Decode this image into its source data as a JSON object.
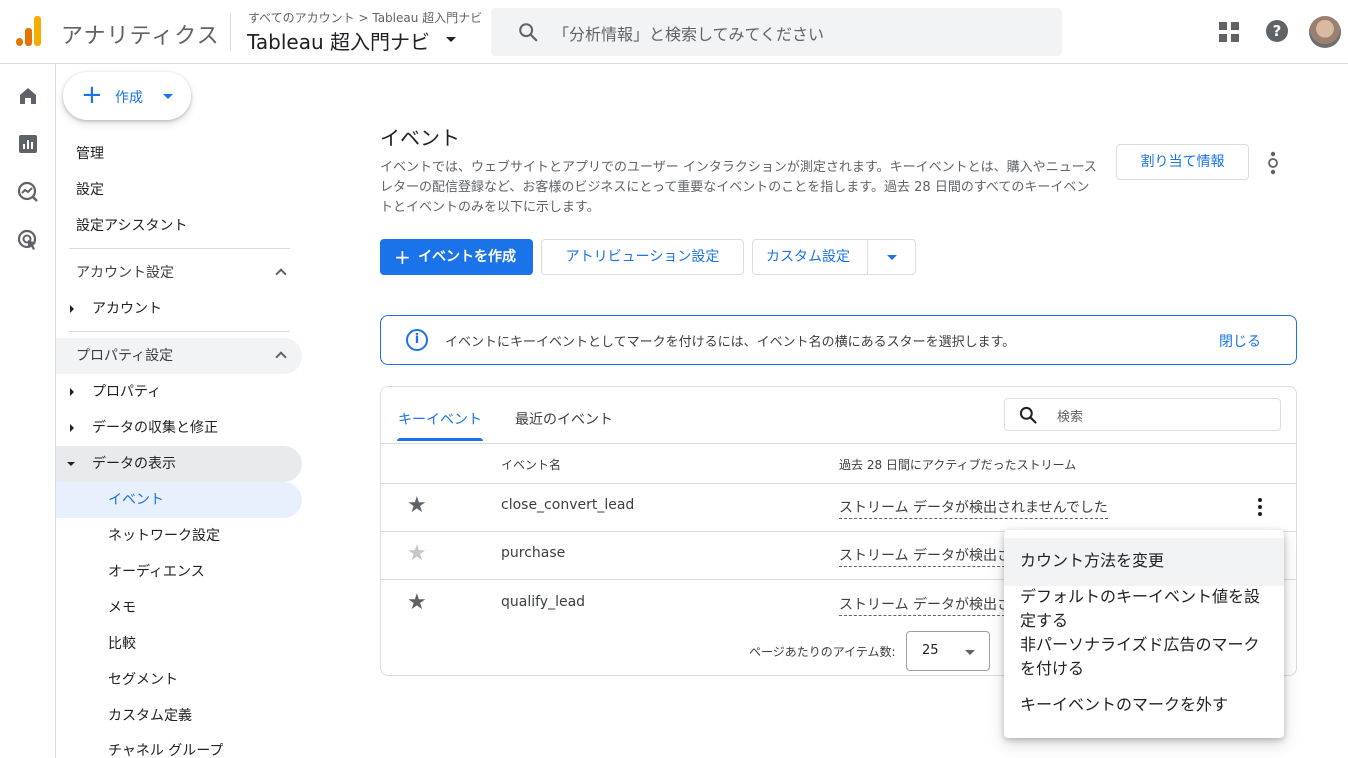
{
  "header": {
    "app_title": "アナリティクス",
    "breadcrumb": "すべてのアカウント > Tableau 超入門ナビ",
    "property_name": "Tableau 超入門ナビ",
    "search_placeholder": "「分析情報」と検索してみてください"
  },
  "create_button": {
    "label": "作成"
  },
  "nav": {
    "admin": "管理",
    "settings": "設定",
    "setup_assistant": "設定アシスタント",
    "account_settings": "アカウント設定",
    "account": "アカウント",
    "property_settings": "プロパティ設定",
    "property": "プロパティ",
    "data_collection": "データの収集と修正",
    "data_display": "データの表示",
    "events": "イベント",
    "network_settings": "ネットワーク設定",
    "audiences": "オーディエンス",
    "notes": "メモ",
    "comparisons": "比較",
    "segments": "セグメント",
    "custom_definitions": "カスタム定義",
    "channel_groups": "チャネル グループ"
  },
  "main": {
    "title": "イベント",
    "description": "イベントでは、ウェブサイトとアプリでのユーザー インタラクションが測定されます。キーイベントとは、購入やニュースレターの配信登録など、お客様のビジネスにとって重要なイベントのことを指します。過去 28 日間のすべてのキーイベントとイベントのみを以下に示します。",
    "assignment_button": "割り当て情報",
    "create_event_button": "イベントを作成",
    "attribution_button": "アトリビューション設定",
    "custom_button": "カスタム設定"
  },
  "banner": {
    "text": "イベントにキーイベントとしてマークを付けるには、イベント名の横にあるスターを選択します。",
    "close_label": "閉じる"
  },
  "table": {
    "tabs": [
      "キーイベント",
      "最近のイベント"
    ],
    "search_placeholder": "検索",
    "columns": {
      "event_name": "イベント名",
      "streams": "過去 28 日間にアクティブだったストリーム"
    },
    "rows": [
      {
        "name": "close_convert_lead",
        "stream": "ストリーム データが検出されませんでした",
        "starred": true
      },
      {
        "name": "purchase",
        "stream": "ストリーム データが検出されませんでした",
        "starred": false
      },
      {
        "name": "qualify_lead",
        "stream": "ストリーム データが検出されませんでした",
        "starred": true
      }
    ],
    "per_page_label": "ページあたりのアイテム数:",
    "per_page_value": "25"
  },
  "context_menu": {
    "items": [
      "カウント方法を変更",
      "デフォルトのキーイベント値を設定する",
      "非パーソナライズド広告のマークを付ける",
      "キーイベントのマークを外す"
    ]
  },
  "colors": {
    "accent": "#1a73e8",
    "star_on": "#5f6368",
    "star_off": "#c4c7c5",
    "nav_selected": "#e8f0fe",
    "nav_hover": "#e8eaed"
  }
}
